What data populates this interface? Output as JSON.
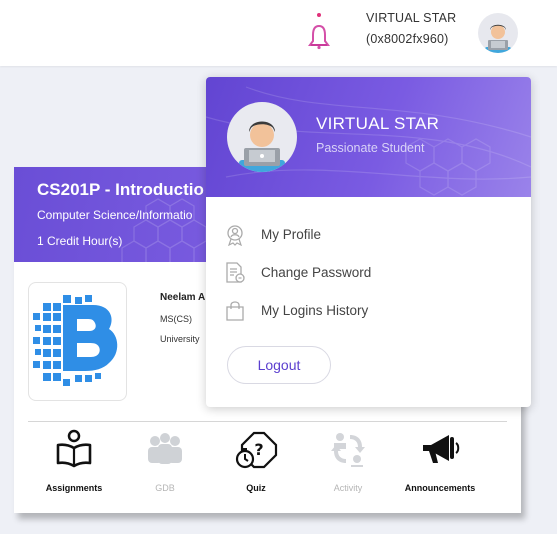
{
  "header": {
    "user_name": "VIRTUAL STAR",
    "user_id": "(0x8002fx960)"
  },
  "course_card": {
    "title": "CS201P - Introductio",
    "department": "Computer Science/Informatio",
    "credit": "1 Credit Hour(s)",
    "teacher_name": "Neelam A",
    "teacher_degree": "MS(CS)",
    "teacher_university": "University",
    "activities": [
      {
        "label": "Assignments",
        "enabled": true,
        "icon": "book-reader-icon"
      },
      {
        "label": "GDB",
        "enabled": false,
        "icon": "group-icon"
      },
      {
        "label": "Quiz",
        "enabled": true,
        "icon": "quiz-timer-icon"
      },
      {
        "label": "Activity",
        "enabled": false,
        "icon": "activity-cycle-icon"
      },
      {
        "label": "Announcements",
        "enabled": true,
        "icon": "megaphone-icon"
      }
    ]
  },
  "dropdown": {
    "name": "VIRTUAL STAR",
    "role": "Passionate Student",
    "items": [
      {
        "label": "My Profile",
        "icon": "profile-badge-icon"
      },
      {
        "label": "Change Password",
        "icon": "document-lock-icon"
      },
      {
        "label": "My Logins History",
        "icon": "bag-icon"
      }
    ],
    "logout_label": "Logout"
  },
  "colors": {
    "accent": "#6a4ed6",
    "accent_light": "#9a83ea",
    "bell": "#d44fa8",
    "logo_blue": "#2f8ee6"
  }
}
